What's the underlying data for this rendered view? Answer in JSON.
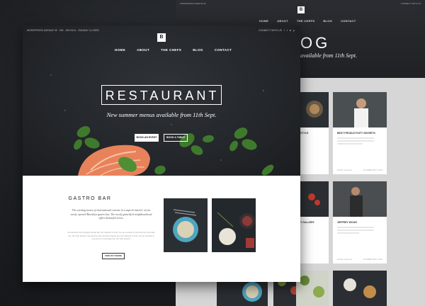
{
  "front": {
    "topbar": {
      "address": "WORDPRESS AVENUE 99",
      "phone": "999 - 999 9414 - SUNDAY CLOSED",
      "connect": "CONNECT WITH US"
    },
    "logo": "B",
    "nav": [
      "HOME",
      "ABOUT",
      "THE CHEFS",
      "BLOG",
      "CONTACT"
    ],
    "hero_title": "RESTAURANT",
    "hero_subtitle": "New summer menus available from 11th Sept.",
    "buttons": {
      "primary": "BOOK AN EVENT",
      "secondary": "BOOK A TABLE"
    },
    "section": {
      "title": "GASTRO BAR",
      "lead": "The exciting tastes of international cuisine in a superb interior of our newly opened Brooklyn gastro bar. The newly gentrified neighbourhood offers beautiful views.",
      "body": "Sometimes the simplest things are the hardest to find. So we created a new line for everyday life. All Year Round. Sometimes the simplest things are the hardest to find. So we created a new line for everyday life. All Year Round.",
      "button": "FIND OUT MORE"
    }
  },
  "back": {
    "logo": "B",
    "nav": [
      "HOME",
      "ABOUT",
      "THE CHEFS",
      "BLOG",
      "CONTACT"
    ],
    "title_visible": "OG",
    "subtitle_visible": "available from 11th Sept.",
    "cards": [
      {
        "heading": "STYLE",
        "footer": "",
        "date": ""
      },
      {
        "heading": "BEST PRODUCTIVITY SECRETS",
        "footer": "Robert Johnson",
        "date": "13 FEBRUARY 2016"
      },
      {
        "heading": "Y GALLERY",
        "footer": "",
        "date": ""
      },
      {
        "heading": "JEFFREY WOOH",
        "footer": "Robert Johnson",
        "date": "13 FEBRUARY 2016"
      }
    ]
  },
  "colors": {
    "hero_bg": "#23262a",
    "page_bg": "#1c1e21",
    "blog_bg": "#d6d6d6",
    "basil": "#3f7a2c",
    "salmon": "#e8825b"
  }
}
